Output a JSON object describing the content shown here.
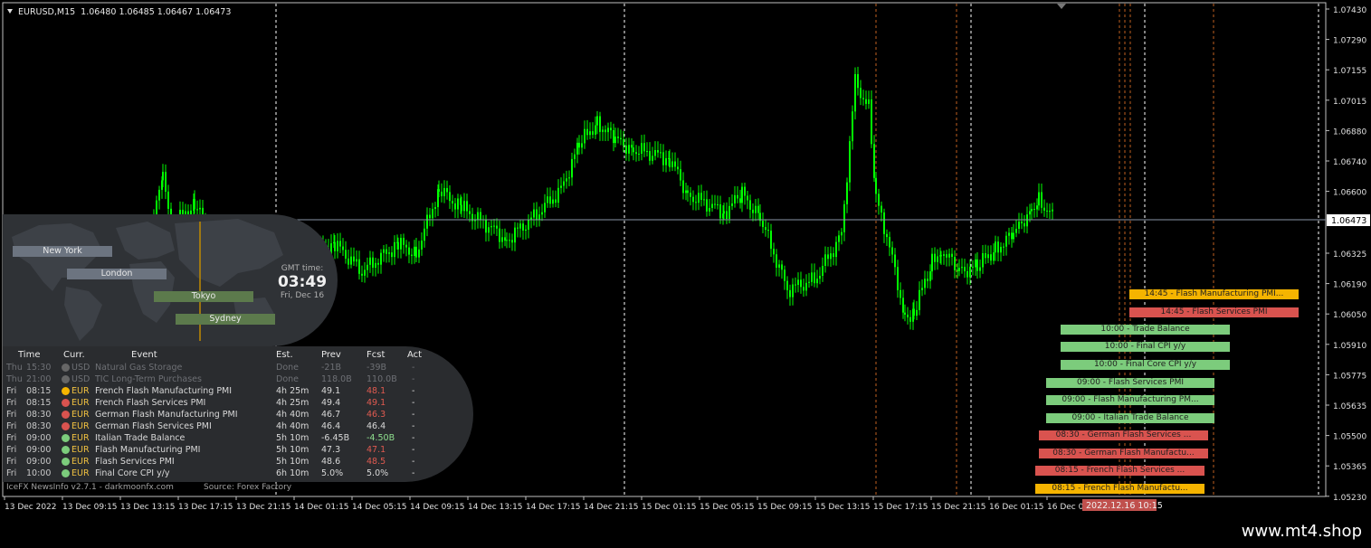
{
  "header": {
    "symbol": "EURUSD,M15",
    "ohlc": "1.06480 1.06485 1.06467 1.06473"
  },
  "price_axis": {
    "labels": [
      "1.07430",
      "1.07290",
      "1.07155",
      "1.07015",
      "1.06880",
      "1.06740",
      "1.06600",
      "1.06325",
      "1.06190",
      "1.06050",
      "1.05910",
      "1.05775",
      "1.05635",
      "1.05500",
      "1.05365",
      "1.05230"
    ],
    "current": "1.06473"
  },
  "time_axis": {
    "labels": [
      "13 Dec 2022",
      "13 Dec 09:15",
      "13 Dec 13:15",
      "13 Dec 17:15",
      "13 Dec 21:15",
      "14 Dec 01:15",
      "14 Dec 05:15",
      "14 Dec 09:15",
      "14 Dec 13:15",
      "14 Dec 17:15",
      "14 Dec 21:15",
      "15 Dec 01:15",
      "15 Dec 05:15",
      "15 Dec 09:15",
      "15 Dec 13:15",
      "15 Dec 17:15",
      "15 Dec 21:15",
      "16 Dec 01:15",
      "16 Dec 05"
    ],
    "cursor_label": "2022.12.16 10:15"
  },
  "clock": {
    "title": "GMT time:",
    "time": "03:49",
    "date": "Fri, Dec 16"
  },
  "sessions": [
    "New York",
    "London",
    "Tokyo",
    "Sydney"
  ],
  "news": {
    "headers": {
      "time": "Time",
      "curr": "Curr.",
      "event": "Event",
      "est": "Est.",
      "prev": "Prev",
      "fcst": "Fcst",
      "act": "Act"
    },
    "rows": [
      {
        "day": "Thu",
        "time": "15:30",
        "cur": "USD",
        "event": "Natural Gas Storage",
        "est": "Done",
        "prev": "-21B",
        "fcst": "-39B",
        "act": "-",
        "impact": "none",
        "dim": true
      },
      {
        "day": "Thu",
        "time": "21:00",
        "cur": "USD",
        "event": "TIC Long-Term Purchases",
        "est": "Done",
        "prev": "118.0B",
        "fcst": "110.0B",
        "act": "-",
        "impact": "none",
        "dim": true
      },
      {
        "day": "Fri",
        "time": "08:15",
        "cur": "EUR",
        "event": "French Flash Manufacturing PMI",
        "est": "4h 25m",
        "prev": "49.1",
        "fcst": "48.1",
        "act": "-",
        "impact": "med",
        "fc": "red"
      },
      {
        "day": "Fri",
        "time": "08:15",
        "cur": "EUR",
        "event": "French Flash Services PMI",
        "est": "4h 25m",
        "prev": "49.4",
        "fcst": "49.1",
        "act": "-",
        "impact": "high",
        "fc": "red"
      },
      {
        "day": "Fri",
        "time": "08:30",
        "cur": "EUR",
        "event": "German Flash Manufacturing PMI",
        "est": "4h 40m",
        "prev": "46.7",
        "fcst": "46.3",
        "act": "-",
        "impact": "high",
        "fc": "red"
      },
      {
        "day": "Fri",
        "time": "08:30",
        "cur": "EUR",
        "event": "German Flash Services PMI",
        "est": "4h 40m",
        "prev": "46.4",
        "fcst": "46.4",
        "act": "-",
        "impact": "high",
        "fc": "white"
      },
      {
        "day": "Fri",
        "time": "09:00",
        "cur": "EUR",
        "event": "Italian Trade Balance",
        "est": "5h 10m",
        "prev": "-6.45B",
        "fcst": "-4.50B",
        "act": "-",
        "impact": "low",
        "fc": "green"
      },
      {
        "day": "Fri",
        "time": "09:00",
        "cur": "EUR",
        "event": "Flash Manufacturing PMI",
        "est": "5h 10m",
        "prev": "47.3",
        "fcst": "47.1",
        "act": "-",
        "impact": "low",
        "fc": "red"
      },
      {
        "day": "Fri",
        "time": "09:00",
        "cur": "EUR",
        "event": "Flash Services PMI",
        "est": "5h 10m",
        "prev": "48.6",
        "fcst": "48.5",
        "act": "-",
        "impact": "low",
        "fc": "red"
      },
      {
        "day": "Fri",
        "time": "10:00",
        "cur": "EUR",
        "event": "Final Core CPI y/y",
        "est": "6h 10m",
        "prev": "5.0%",
        "fcst": "5.0%",
        "act": "-",
        "impact": "low",
        "fc": "white"
      }
    ],
    "footer_left": "IceFX NewsInfo v2.7.1  -  darkmoonfx.com",
    "footer_right": "Source: Forex Factory"
  },
  "event_bars": [
    {
      "label": "14:45 - Flash Manufacturing PMI...",
      "color": "#f5b400",
      "text": "#202020"
    },
    {
      "label": "14:45 - Flash Services PMI",
      "color": "#d9534f",
      "text": "#202020"
    },
    {
      "label": "10:00 - Trade Balance",
      "color": "#7ccc7c",
      "text": "#202020"
    },
    {
      "label": "10:00 - Final CPI y/y",
      "color": "#7ccc7c",
      "text": "#202020"
    },
    {
      "label": "10:00 - Final Core CPI y/y",
      "color": "#7ccc7c",
      "text": "#202020"
    },
    {
      "label": "09:00 - Flash Services PMI",
      "color": "#7ccc7c",
      "text": "#202020"
    },
    {
      "label": "09:00 - Flash Manufacturing PM...",
      "color": "#7ccc7c",
      "text": "#202020"
    },
    {
      "label": "09:00 - Italian Trade Balance",
      "color": "#7ccc7c",
      "text": "#202020"
    },
    {
      "label": "08:30 - German Flash Services ...",
      "color": "#d9534f",
      "text": "#202020"
    },
    {
      "label": "08:30 - German Flash Manufactu...",
      "color": "#d9534f",
      "text": "#202020"
    },
    {
      "label": "08:15 - French Flash Services ...",
      "color": "#d9534f",
      "text": "#202020"
    },
    {
      "label": "08:15 - French Flash Manufactu...",
      "color": "#f5b400",
      "text": "#202020"
    }
  ],
  "colors": {
    "candle": "#00ff00",
    "bg": "#000000",
    "grid_white": "#ffffff",
    "grid_orange": "#c06020",
    "impact_high": "#d9534f",
    "impact_med": "#f5b400",
    "impact_low": "#7ccc7c",
    "impact_none": "#666666"
  },
  "watermark": "www.mt4.shop"
}
